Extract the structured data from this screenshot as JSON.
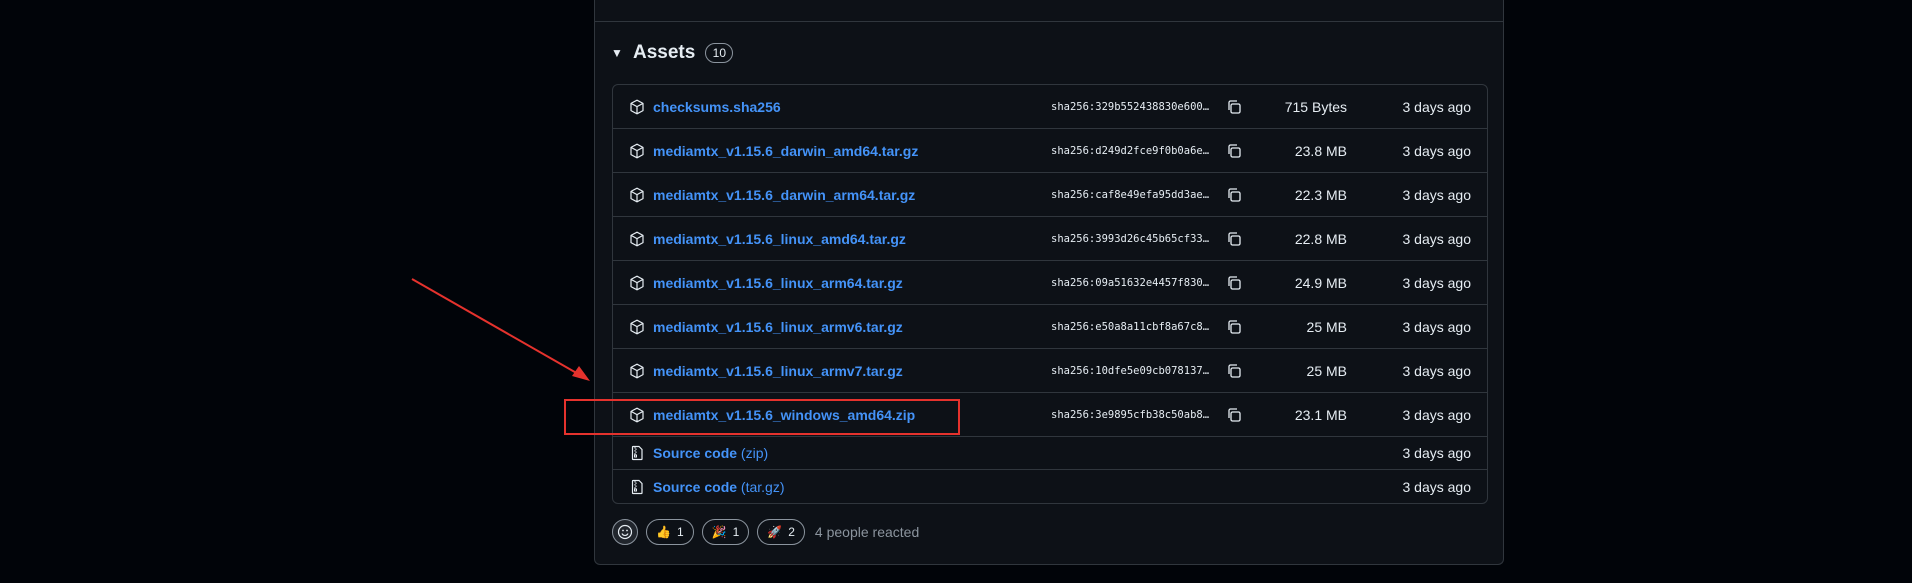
{
  "assets": {
    "title": "Assets",
    "count": "10",
    "caret_icon": "triangle-down-icon",
    "rows": [
      {
        "name": "checksums.sha256",
        "sha": "sha256:329b552438830e600…",
        "size": "715 Bytes",
        "date": "3 days ago"
      },
      {
        "name": "mediamtx_v1.15.6_darwin_amd64.tar.gz",
        "sha": "sha256:d249d2fce9f0b0a6e…",
        "size": "23.8 MB",
        "date": "3 days ago"
      },
      {
        "name": "mediamtx_v1.15.6_darwin_arm64.tar.gz",
        "sha": "sha256:caf8e49efa95dd3ae…",
        "size": "22.3 MB",
        "date": "3 days ago"
      },
      {
        "name": "mediamtx_v1.15.6_linux_amd64.tar.gz",
        "sha": "sha256:3993d26c45b65cf33…",
        "size": "22.8 MB",
        "date": "3 days ago"
      },
      {
        "name": "mediamtx_v1.15.6_linux_arm64.tar.gz",
        "sha": "sha256:09a51632e4457f830…",
        "size": "24.9 MB",
        "date": "3 days ago"
      },
      {
        "name": "mediamtx_v1.15.6_linux_armv6.tar.gz",
        "sha": "sha256:e50a8a11cbf8a67c8…",
        "size": "25 MB",
        "date": "3 days ago"
      },
      {
        "name": "mediamtx_v1.15.6_linux_armv7.tar.gz",
        "sha": "sha256:10dfe5e09cb078137…",
        "size": "25 MB",
        "date": "3 days ago"
      },
      {
        "name": "mediamtx_v1.15.6_windows_amd64.zip",
        "sha": "sha256:3e9895cfb38c50ab8…",
        "size": "23.1 MB",
        "date": "3 days ago"
      }
    ],
    "source": [
      {
        "label": "Source code",
        "format": "(zip)",
        "date": "3 days ago"
      },
      {
        "label": "Source code",
        "format": "(tar.gz)",
        "date": "3 days ago"
      }
    ]
  },
  "reactions": {
    "thumbs_up": {
      "emoji": "👍",
      "count": "1"
    },
    "hooray": {
      "emoji": "🎉",
      "count": "1"
    },
    "rocket": {
      "emoji": "🚀",
      "count": "2"
    },
    "summary": "4 people reacted"
  },
  "colors": {
    "background": "#010409",
    "card": "#0d1117",
    "border": "#30363d",
    "link": "#4493f8",
    "annotation": "#e5322d"
  }
}
